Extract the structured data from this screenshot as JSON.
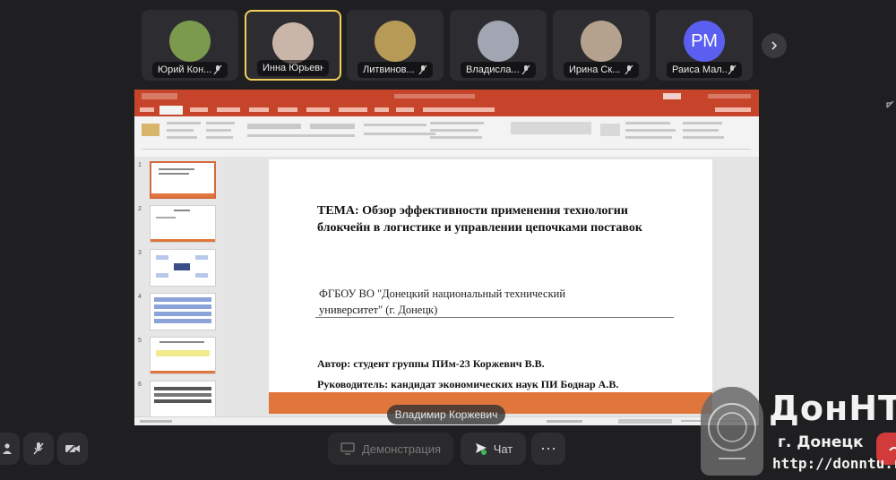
{
  "participants": [
    {
      "name": "Юрий Кон...",
      "type": "photo",
      "color": "#7c9a4e"
    },
    {
      "name": "Инна Юрьевн...",
      "type": "photo",
      "color": "#c9b6a8",
      "active": true
    },
    {
      "name": "Литвинов...",
      "type": "photo",
      "color": "#b79a56"
    },
    {
      "name": "Владисла...",
      "type": "photo",
      "color": "#a2a6b2"
    },
    {
      "name": "Ирина Ск...",
      "type": "photo",
      "color": "#b4a28f"
    },
    {
      "name": "Раиса Мал...",
      "type": "initials",
      "initials": "РМ",
      "color": "#5a5ff0"
    }
  ],
  "slide": {
    "title": "ТЕМА: Обзор эффективности применения технологии блокчейн в логистике и управлении цепочками поставок",
    "org": "ФГБОУ ВО \"Донецкий национальный технический университет\" (г. Донецк)",
    "author": "Автор: студент группы ПИм-23 Коржевич В.В.",
    "supervisor": "Руководитель: кандидат экономических наук ПИ Боднар А.В."
  },
  "thumbnail_numbers": [
    "1",
    "2",
    "3",
    "4",
    "5",
    "6"
  ],
  "presenter_name": "Владимир Коржевич",
  "toolbar": {
    "demo_label": "Демонстрация",
    "chat_label": "Чат",
    "more_label": "⋯"
  },
  "watermark": {
    "title": "ДонНТУ",
    "city": "г. Донецк",
    "url": "http://donntu.ru"
  },
  "colors": {
    "accent_ppt": "#c6452a",
    "slide_bar": "#e0763b",
    "active_border": "#f2cf5b",
    "initials_bg": "#5a5ff0"
  }
}
